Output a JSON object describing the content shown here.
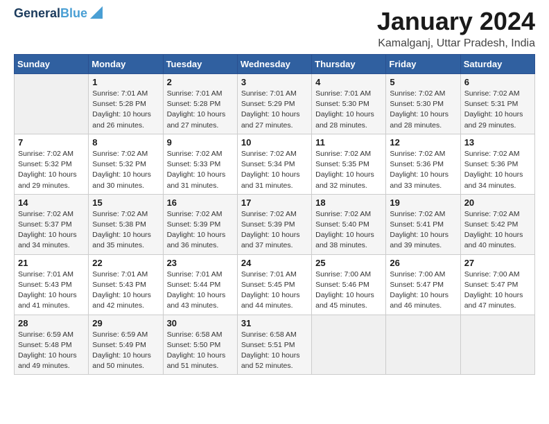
{
  "header": {
    "logo_line1": "General",
    "logo_line2": "Blue",
    "title": "January 2024",
    "subtitle": "Kamalganj, Uttar Pradesh, India"
  },
  "calendar": {
    "days_of_week": [
      "Sunday",
      "Monday",
      "Tuesday",
      "Wednesday",
      "Thursday",
      "Friday",
      "Saturday"
    ],
    "weeks": [
      [
        {
          "day": "",
          "info": ""
        },
        {
          "day": "1",
          "info": "Sunrise: 7:01 AM\nSunset: 5:28 PM\nDaylight: 10 hours\nand 26 minutes."
        },
        {
          "day": "2",
          "info": "Sunrise: 7:01 AM\nSunset: 5:28 PM\nDaylight: 10 hours\nand 27 minutes."
        },
        {
          "day": "3",
          "info": "Sunrise: 7:01 AM\nSunset: 5:29 PM\nDaylight: 10 hours\nand 27 minutes."
        },
        {
          "day": "4",
          "info": "Sunrise: 7:01 AM\nSunset: 5:30 PM\nDaylight: 10 hours\nand 28 minutes."
        },
        {
          "day": "5",
          "info": "Sunrise: 7:02 AM\nSunset: 5:30 PM\nDaylight: 10 hours\nand 28 minutes."
        },
        {
          "day": "6",
          "info": "Sunrise: 7:02 AM\nSunset: 5:31 PM\nDaylight: 10 hours\nand 29 minutes."
        }
      ],
      [
        {
          "day": "7",
          "info": "Sunrise: 7:02 AM\nSunset: 5:32 PM\nDaylight: 10 hours\nand 29 minutes."
        },
        {
          "day": "8",
          "info": "Sunrise: 7:02 AM\nSunset: 5:32 PM\nDaylight: 10 hours\nand 30 minutes."
        },
        {
          "day": "9",
          "info": "Sunrise: 7:02 AM\nSunset: 5:33 PM\nDaylight: 10 hours\nand 31 minutes."
        },
        {
          "day": "10",
          "info": "Sunrise: 7:02 AM\nSunset: 5:34 PM\nDaylight: 10 hours\nand 31 minutes."
        },
        {
          "day": "11",
          "info": "Sunrise: 7:02 AM\nSunset: 5:35 PM\nDaylight: 10 hours\nand 32 minutes."
        },
        {
          "day": "12",
          "info": "Sunrise: 7:02 AM\nSunset: 5:36 PM\nDaylight: 10 hours\nand 33 minutes."
        },
        {
          "day": "13",
          "info": "Sunrise: 7:02 AM\nSunset: 5:36 PM\nDaylight: 10 hours\nand 34 minutes."
        }
      ],
      [
        {
          "day": "14",
          "info": "Sunrise: 7:02 AM\nSunset: 5:37 PM\nDaylight: 10 hours\nand 34 minutes."
        },
        {
          "day": "15",
          "info": "Sunrise: 7:02 AM\nSunset: 5:38 PM\nDaylight: 10 hours\nand 35 minutes."
        },
        {
          "day": "16",
          "info": "Sunrise: 7:02 AM\nSunset: 5:39 PM\nDaylight: 10 hours\nand 36 minutes."
        },
        {
          "day": "17",
          "info": "Sunrise: 7:02 AM\nSunset: 5:39 PM\nDaylight: 10 hours\nand 37 minutes."
        },
        {
          "day": "18",
          "info": "Sunrise: 7:02 AM\nSunset: 5:40 PM\nDaylight: 10 hours\nand 38 minutes."
        },
        {
          "day": "19",
          "info": "Sunrise: 7:02 AM\nSunset: 5:41 PM\nDaylight: 10 hours\nand 39 minutes."
        },
        {
          "day": "20",
          "info": "Sunrise: 7:02 AM\nSunset: 5:42 PM\nDaylight: 10 hours\nand 40 minutes."
        }
      ],
      [
        {
          "day": "21",
          "info": "Sunrise: 7:01 AM\nSunset: 5:43 PM\nDaylight: 10 hours\nand 41 minutes."
        },
        {
          "day": "22",
          "info": "Sunrise: 7:01 AM\nSunset: 5:43 PM\nDaylight: 10 hours\nand 42 minutes."
        },
        {
          "day": "23",
          "info": "Sunrise: 7:01 AM\nSunset: 5:44 PM\nDaylight: 10 hours\nand 43 minutes."
        },
        {
          "day": "24",
          "info": "Sunrise: 7:01 AM\nSunset: 5:45 PM\nDaylight: 10 hours\nand 44 minutes."
        },
        {
          "day": "25",
          "info": "Sunrise: 7:00 AM\nSunset: 5:46 PM\nDaylight: 10 hours\nand 45 minutes."
        },
        {
          "day": "26",
          "info": "Sunrise: 7:00 AM\nSunset: 5:47 PM\nDaylight: 10 hours\nand 46 minutes."
        },
        {
          "day": "27",
          "info": "Sunrise: 7:00 AM\nSunset: 5:47 PM\nDaylight: 10 hours\nand 47 minutes."
        }
      ],
      [
        {
          "day": "28",
          "info": "Sunrise: 6:59 AM\nSunset: 5:48 PM\nDaylight: 10 hours\nand 49 minutes."
        },
        {
          "day": "29",
          "info": "Sunrise: 6:59 AM\nSunset: 5:49 PM\nDaylight: 10 hours\nand 50 minutes."
        },
        {
          "day": "30",
          "info": "Sunrise: 6:58 AM\nSunset: 5:50 PM\nDaylight: 10 hours\nand 51 minutes."
        },
        {
          "day": "31",
          "info": "Sunrise: 6:58 AM\nSunset: 5:51 PM\nDaylight: 10 hours\nand 52 minutes."
        },
        {
          "day": "",
          "info": ""
        },
        {
          "day": "",
          "info": ""
        },
        {
          "day": "",
          "info": ""
        }
      ]
    ]
  }
}
